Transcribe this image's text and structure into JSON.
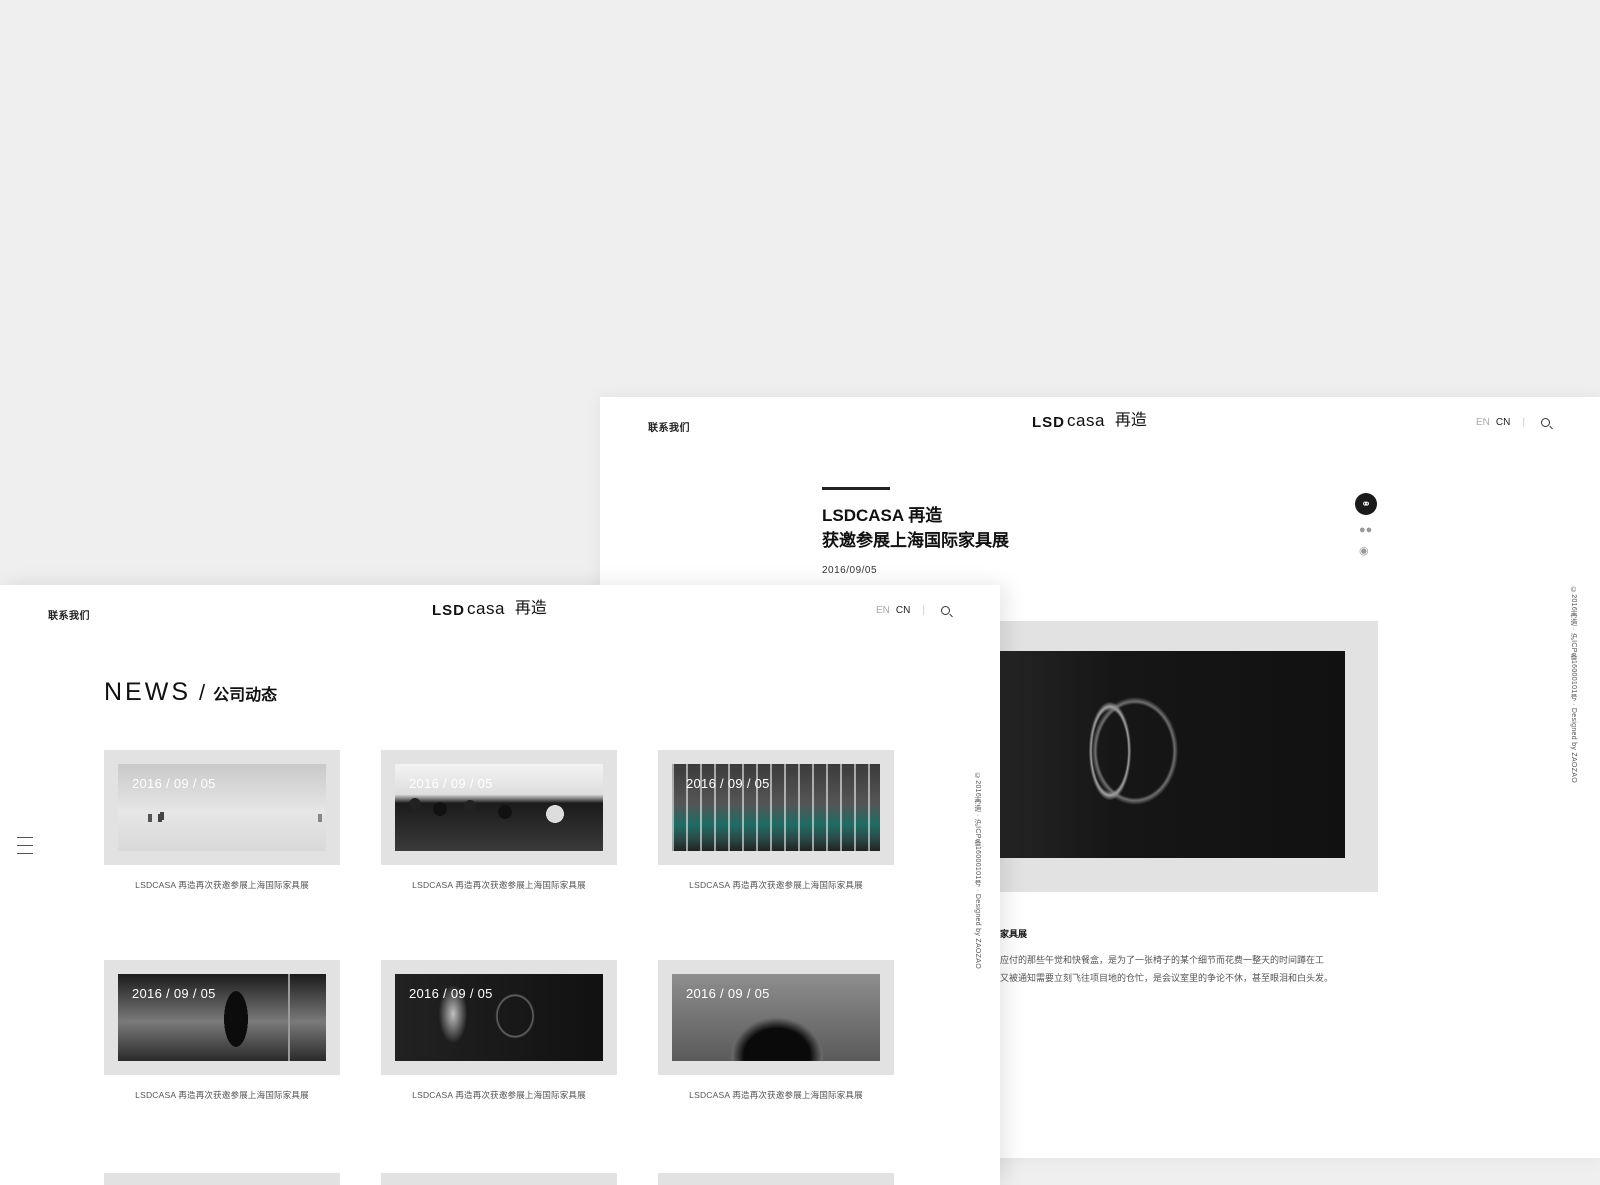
{
  "detail_page": {
    "header": {
      "contact": "联系我们",
      "logo_lsd": "LSD",
      "logo_casa": "casa",
      "logo_zh": "再造",
      "lang_en": "EN",
      "lang_cn": "CN"
    },
    "title_line1": "LSDCASA 再造",
    "title_line2": "获邀参展上海国际家具展",
    "date": "2016/09/05",
    "copyright": "©2016再造 · 沪ICP备16000101号 · Designed by ZAOZAO",
    "sub_title": "家具展",
    "body_line1": "应付的那些午觉和快餐盒，是为了一张椅子的某个细节而花费一整天的时间蹲在工",
    "body_line2": "又被通知需要立刻飞往项目地的仓忙，是会议室里的争论不休，甚至眼泪和白头发。"
  },
  "list_page": {
    "header": {
      "contact": "联系我们",
      "logo_lsd": "LSD",
      "logo_casa": "casa",
      "logo_zh": "再造",
      "lang_en": "EN",
      "lang_cn": "CN"
    },
    "heading_en": "NEWS",
    "heading_slash": "/",
    "heading_zh": "公司动态",
    "copyright": "©2016再造 · 沪ICP备16000101号 · Designed by ZAOZAO",
    "cards": [
      {
        "date": "2016 / 09 / 05",
        "caption": "LSDCASA 再造再次获邀参展上海国际家具展"
      },
      {
        "date": "2016 / 09 / 05",
        "caption": "LSDCASA 再造再次获邀参展上海国际家具展"
      },
      {
        "date": "2016 / 09 / 05",
        "caption": "LSDCASA 再造再次获邀参展上海国际家具展"
      },
      {
        "date": "2016 / 09 / 05",
        "caption": "LSDCASA 再造再次获邀参展上海国际家具展"
      },
      {
        "date": "2016 / 09 / 05",
        "caption": "LSDCASA 再造再次获邀参展上海国际家具展"
      },
      {
        "date": "2016 / 09 / 05",
        "caption": "LSDCASA 再造再次获邀参展上海国际家具展"
      }
    ]
  },
  "icons": {
    "share": "share-icon",
    "wechat": "wechat-icon",
    "weibo": "weibo-icon",
    "search": "search-icon",
    "menu": "menu-icon"
  }
}
